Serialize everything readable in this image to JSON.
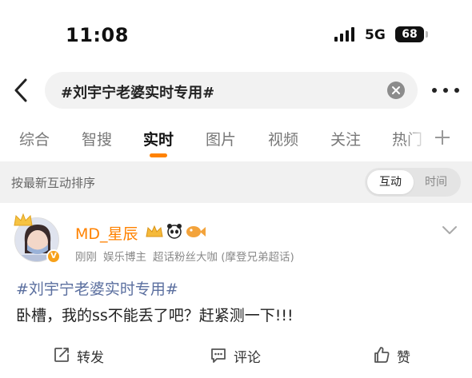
{
  "status_bar": {
    "time": "11:08",
    "network": "5G",
    "battery": "68"
  },
  "search": {
    "query": "#刘宇宁老婆实时专用#"
  },
  "tabs": [
    {
      "label": "综合",
      "active": false
    },
    {
      "label": "智搜",
      "active": false
    },
    {
      "label": "实时",
      "active": true
    },
    {
      "label": "图片",
      "active": false
    },
    {
      "label": "视频",
      "active": false
    },
    {
      "label": "关注",
      "active": false
    },
    {
      "label": "热门",
      "active": false
    }
  ],
  "sort": {
    "label": "按最新互动排序",
    "options": [
      "互动",
      "时间"
    ],
    "selected": "互动"
  },
  "post": {
    "username": "MD_星辰",
    "meta": [
      "刚刚",
      "娱乐博主",
      "超话粉丝大咖 (摩登兄弟超话)"
    ],
    "hashtag": "#刘宇宁老婆实时专用#",
    "text": "卧槽，我的ss不能丢了吧？赶紧测一下!!!",
    "actions": {
      "repost": "转发",
      "comment": "评论",
      "like": "赞"
    }
  },
  "colors": {
    "accent": "#ff8200",
    "hashtag": "#5b6f9f",
    "sort_bar_bg": "#f1f1f1"
  },
  "icons": [
    "back-arrow-icon",
    "clear-icon",
    "more-icon",
    "plus-icon",
    "chevron-down-icon",
    "repost-icon",
    "comment-icon",
    "like-icon",
    "verified-v-icon",
    "crown-icon"
  ]
}
